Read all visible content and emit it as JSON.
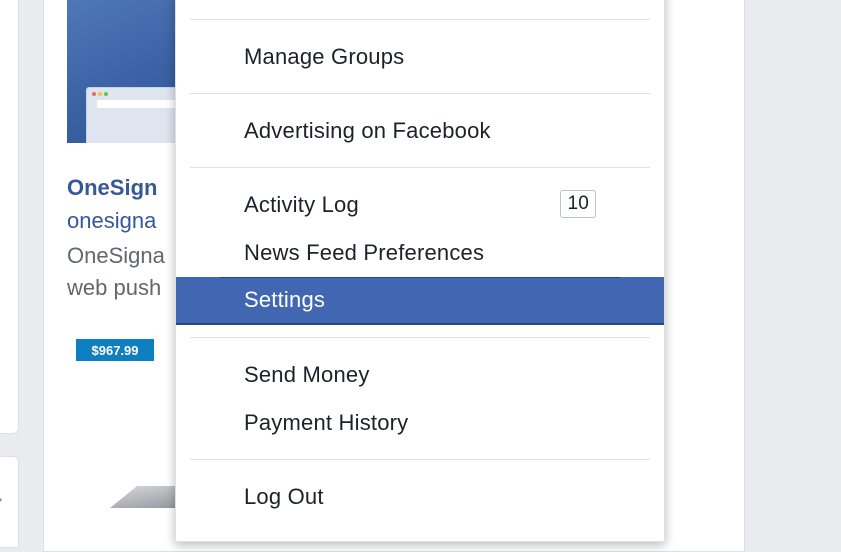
{
  "ad": {
    "title": "OneSign",
    "domain": "onesigna",
    "description_line1": "OneSigna",
    "description_line2": "web push",
    "price": "$967.99"
  },
  "menu": {
    "items": [
      {
        "label": "Manage Groups"
      },
      {
        "label": "Advertising on Facebook"
      },
      {
        "label": "Activity Log",
        "badge": "10"
      },
      {
        "label": "News Feed Preferences"
      },
      {
        "label": "Settings",
        "selected": true
      },
      {
        "label": "Send Money"
      },
      {
        "label": "Payment History"
      },
      {
        "label": "Log Out"
      }
    ]
  },
  "colors": {
    "selected_bg": "#4267b2",
    "link_blue": "#365899",
    "price_badge": "#0e7fc1",
    "page_bg": "#e9ebee"
  }
}
